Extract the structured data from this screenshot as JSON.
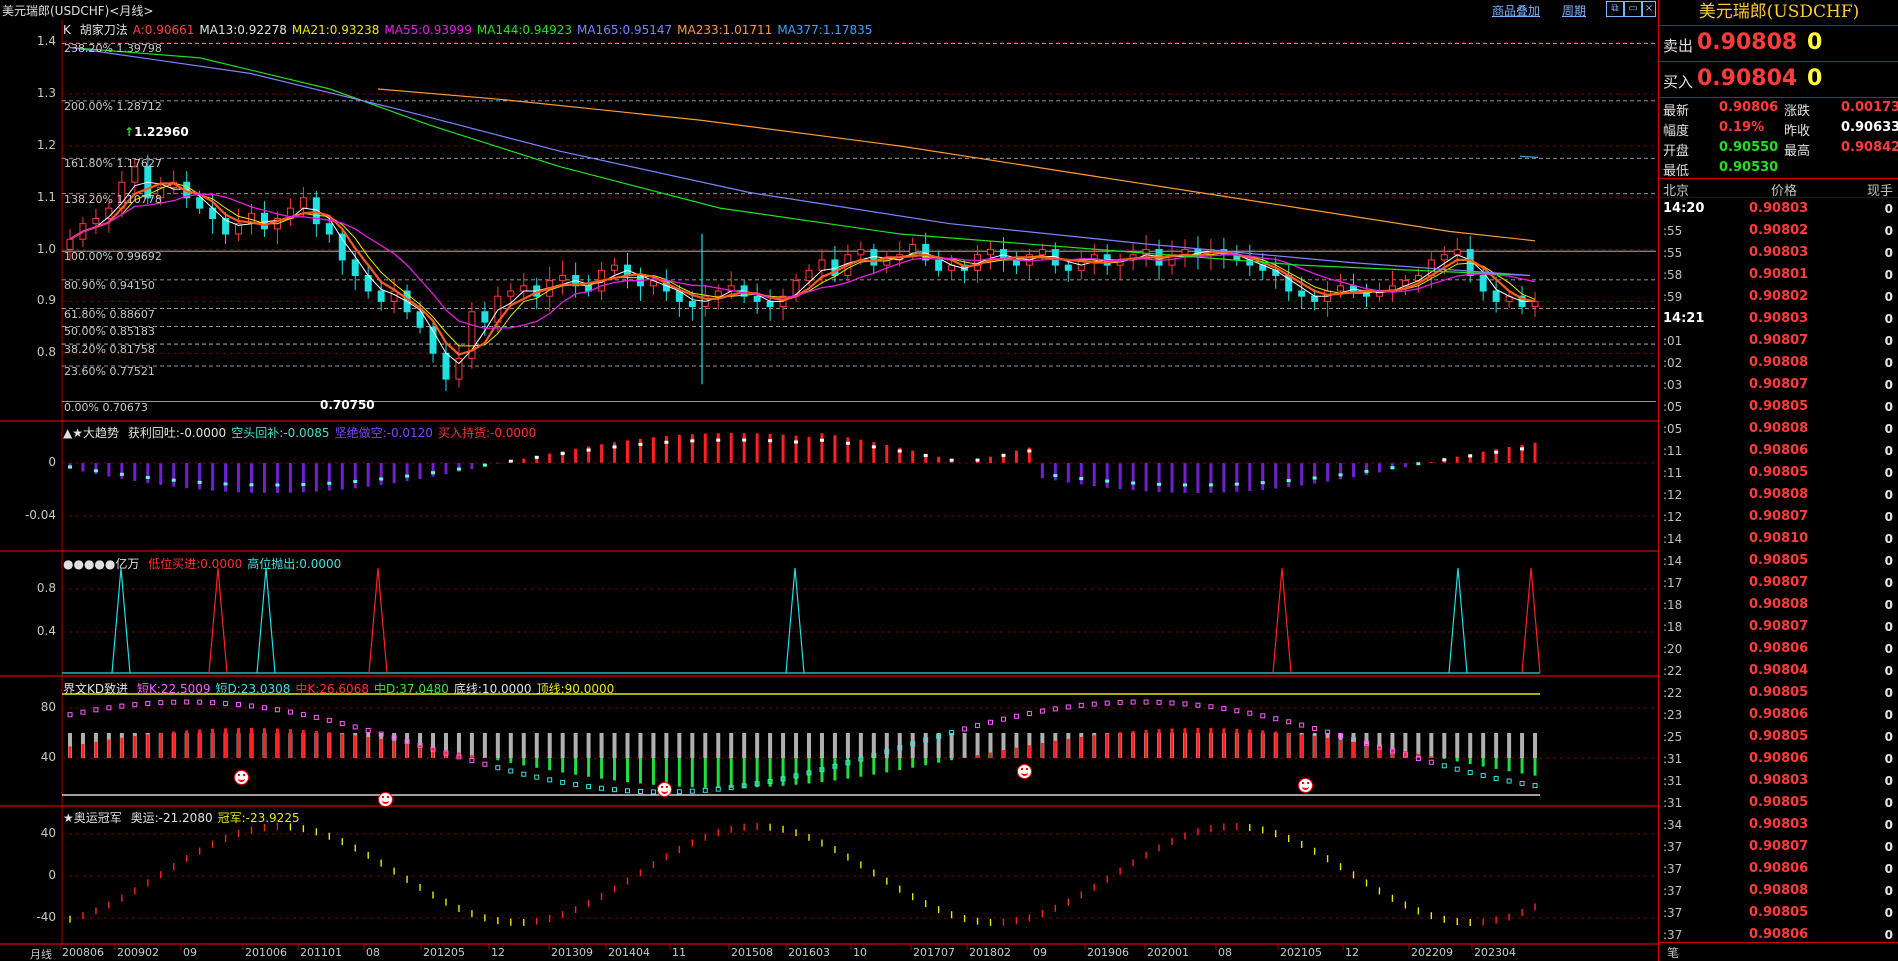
{
  "window_title": "美元瑞郎(USDCHF)<月线>",
  "toolbar": {
    "overlay_link": "商品叠加",
    "period_link": "周期"
  },
  "main": {
    "label_prefix": "K",
    "indicators": [
      {
        "text": "胡家刀法",
        "color": "#e0e0e0"
      },
      {
        "text": "A:0.90661",
        "color": "#ff4040"
      },
      {
        "text": "MA13:0.92278",
        "color": "#e0e0e0"
      },
      {
        "text": "MA21:0.93238",
        "color": "#e8e800"
      },
      {
        "text": "MA55:0.93999",
        "color": "#e020e0"
      },
      {
        "text": "MA144:0.94923",
        "color": "#20e020"
      },
      {
        "text": "MA165:0.95147",
        "color": "#8080ff"
      },
      {
        "text": "MA233:1.01711",
        "color": "#ff9933"
      },
      {
        "text": "MA377:1.17835",
        "color": "#40a0ff"
      }
    ],
    "y_ticks": [
      "1.4",
      "1.3",
      "1.2",
      "1.1",
      "1.0",
      "0.9",
      "0.8"
    ],
    "fib_levels": [
      {
        "label": "238.20% 1.39798",
        "value": 1.39798
      },
      {
        "label": "200.00% 1.28712",
        "value": 1.28712
      },
      {
        "label": "161.80% 1.17627",
        "value": 1.17627
      },
      {
        "label": "138.20% 1.10778",
        "value": 1.10778
      },
      {
        "label": "100.00% 0.99692",
        "value": 0.99692
      },
      {
        "label": "80.90% 0.94150",
        "value": 0.9415
      },
      {
        "label": "61.80% 0.88607",
        "value": 0.88607
      },
      {
        "label": "50.00% 0.85183",
        "value": 0.85183
      },
      {
        "label": "38.20% 0.81758",
        "value": 0.81758
      },
      {
        "label": "23.60% 0.77521",
        "value": 0.77521
      },
      {
        "label": "0.00% 0.70673",
        "value": 0.70673
      }
    ],
    "high_marker": "1.22960",
    "low_marker": "0.70750"
  },
  "panel_trend": {
    "label": "▲★大趋势",
    "items": [
      {
        "text": "获利回吐:-0.0000",
        "color": "#e0e0e0"
      },
      {
        "text": "空头回补:-0.0085",
        "color": "#40e0d0"
      },
      {
        "text": "坚绝做空:-0.0120",
        "color": "#8040ff"
      },
      {
        "text": "买入持货:-0.0000",
        "color": "#ff3030"
      }
    ],
    "y_ticks": [
      "0",
      "-0.04"
    ]
  },
  "panel_signal": {
    "label": "●●●●●亿万",
    "items": [
      {
        "text": "低位买进:0.0000",
        "color": "#ff3030"
      },
      {
        "text": "高位抛出:0.0000",
        "color": "#40e0e0"
      }
    ],
    "y_ticks": [
      "0.8",
      "0.4"
    ]
  },
  "panel_kd": {
    "label": "界文KD致进",
    "items": [
      {
        "text": "短K:22.5009",
        "color": "#ff60ff"
      },
      {
        "text": "短D:23.0308",
        "color": "#40e0e0"
      },
      {
        "text": "中K:26.6068",
        "color": "#ff3030"
      },
      {
        "text": "中D:37.0480",
        "color": "#40e040"
      },
      {
        "text": "底线:10.0000",
        "color": "#e0e0e0"
      },
      {
        "text": "顶线:90.0000",
        "color": "#e8e800"
      }
    ],
    "y_ticks": [
      "80",
      "40"
    ]
  },
  "panel_olympic": {
    "label": "★奥运冠军",
    "items": [
      {
        "text": "奥运:-21.2080",
        "color": "#e0e0e0"
      },
      {
        "text": "冠军:-23.9225",
        "color": "#e8e800"
      }
    ],
    "y_ticks": [
      "40",
      "0",
      "-40"
    ]
  },
  "x_axis": {
    "period_label": "月线",
    "ticks": [
      "200806",
      "200902",
      "09",
      "201006",
      "201101",
      "08",
      "201205",
      "12",
      "201309",
      "201404",
      "11",
      "201508",
      "201603",
      "10",
      "201707",
      "201802",
      "09",
      "201906",
      "202001",
      "08",
      "202105",
      "12",
      "202209",
      "202304"
    ]
  },
  "chart_data": {
    "type": "candlestick",
    "symbol": "USDCHF",
    "period": "monthly",
    "ylim": [
      0.7,
      1.42
    ],
    "close_path": [
      1.02,
      1.05,
      1.06,
      1.08,
      1.13,
      1.16,
      1.1,
      1.12,
      1.13,
      1.1,
      1.08,
      1.06,
      1.03,
      1.05,
      1.07,
      1.04,
      1.06,
      1.08,
      1.1,
      1.05,
      1.03,
      0.98,
      0.95,
      0.92,
      0.9,
      0.92,
      0.88,
      0.85,
      0.8,
      0.75,
      0.79,
      0.88,
      0.86,
      0.91,
      0.92,
      0.93,
      0.91,
      0.94,
      0.95,
      0.93,
      0.92,
      0.96,
      0.97,
      0.95,
      0.93,
      0.94,
      0.92,
      0.9,
      0.89,
      0.91,
      0.92,
      0.93,
      0.91,
      0.9,
      0.89,
      0.91,
      0.94,
      0.96,
      0.98,
      0.95,
      0.99,
      1.0,
      0.97,
      0.98,
      0.99,
      1.01,
      0.98,
      0.96,
      0.97,
      0.96,
      0.99,
      1.0,
      0.98,
      0.97,
      0.99,
      1.0,
      0.97,
      0.96,
      0.98,
      0.99,
      0.97,
      0.98,
      0.99,
      1.0,
      0.97,
      0.99,
      1.0,
      0.99,
      1.0,
      0.99,
      0.98,
      0.97,
      0.96,
      0.95,
      0.92,
      0.91,
      0.9,
      0.92,
      0.93,
      0.92,
      0.91,
      0.92,
      0.93,
      0.94,
      0.95,
      0.98,
      0.99,
      1.0,
      0.95,
      0.92,
      0.9,
      0.91,
      0.89,
      0.9
    ]
  },
  "quote": {
    "title": "美元瑞郎(USDCHF)",
    "sell_label": "卖出",
    "sell_price": "0.90808",
    "sell_vol": "0",
    "buy_label": "买入",
    "buy_price": "0.90804",
    "buy_vol": "0",
    "rows": [
      {
        "l1": "最新",
        "v1": "0.90806",
        "c1": "#ff3c3c",
        "l2": "涨跌",
        "v2": "0.00173",
        "c2": "#ff3c3c"
      },
      {
        "l1": "幅度",
        "v1": "0.19%",
        "c1": "#ff3c3c",
        "l2": "昨收",
        "v2": "0.90633",
        "c2": "#ffffff"
      },
      {
        "l1": "开盘",
        "v1": "0.90550",
        "c1": "#20e020",
        "l2": "最高",
        "v2": "0.90842",
        "c2": "#ff3c3c"
      },
      {
        "l1": "最低",
        "v1": "0.90530",
        "c1": "#20e020",
        "l2": "",
        "v2": "",
        "c2": "#fff"
      }
    ],
    "tick_header": {
      "time": "北京",
      "price": "价格",
      "vol": "现手"
    },
    "ticks": [
      {
        "time": "14:20",
        "full": true,
        "price": "0.90803",
        "vol": "0"
      },
      {
        "time": ":55",
        "price": "0.90802",
        "vol": "0"
      },
      {
        "time": ":55",
        "price": "0.90803",
        "vol": "0"
      },
      {
        "time": ":58",
        "price": "0.90801",
        "vol": "0"
      },
      {
        "time": ":59",
        "price": "0.90802",
        "vol": "0"
      },
      {
        "time": "14:21",
        "full": true,
        "price": "0.90803",
        "vol": "0"
      },
      {
        "time": ":01",
        "price": "0.90807",
        "vol": "0"
      },
      {
        "time": ":02",
        "price": "0.90808",
        "vol": "0"
      },
      {
        "time": ":03",
        "price": "0.90807",
        "vol": "0"
      },
      {
        "time": ":05",
        "price": "0.90805",
        "vol": "0"
      },
      {
        "time": ":05",
        "price": "0.90808",
        "vol": "0"
      },
      {
        "time": ":11",
        "price": "0.90806",
        "vol": "0"
      },
      {
        "time": ":11",
        "price": "0.90805",
        "vol": "0"
      },
      {
        "time": ":12",
        "price": "0.90808",
        "vol": "0"
      },
      {
        "time": ":12",
        "price": "0.90807",
        "vol": "0"
      },
      {
        "time": ":14",
        "price": "0.90810",
        "vol": "0"
      },
      {
        "time": ":14",
        "price": "0.90805",
        "vol": "0"
      },
      {
        "time": ":17",
        "price": "0.90807",
        "vol": "0"
      },
      {
        "time": ":18",
        "price": "0.90808",
        "vol": "0"
      },
      {
        "time": ":18",
        "price": "0.90807",
        "vol": "0"
      },
      {
        "time": ":20",
        "price": "0.90806",
        "vol": "0"
      },
      {
        "time": ":22",
        "price": "0.90804",
        "vol": "0"
      },
      {
        "time": ":22",
        "price": "0.90805",
        "vol": "0"
      },
      {
        "time": ":23",
        "price": "0.90806",
        "vol": "0"
      },
      {
        "time": ":25",
        "price": "0.90805",
        "vol": "0"
      },
      {
        "time": ":31",
        "price": "0.90806",
        "vol": "0"
      },
      {
        "time": ":31",
        "price": "0.90803",
        "vol": "0"
      },
      {
        "time": ":31",
        "price": "0.90805",
        "vol": "0"
      },
      {
        "time": ":34",
        "price": "0.90803",
        "vol": "0"
      },
      {
        "time": ":37",
        "price": "0.90807",
        "vol": "0"
      },
      {
        "time": ":37",
        "price": "0.90806",
        "vol": "0"
      },
      {
        "time": ":37",
        "price": "0.90808",
        "vol": "0"
      },
      {
        "time": ":37",
        "price": "0.90805",
        "vol": "0"
      },
      {
        "time": ":37",
        "price": "0.90806",
        "vol": "0"
      }
    ],
    "footer": "笔"
  }
}
